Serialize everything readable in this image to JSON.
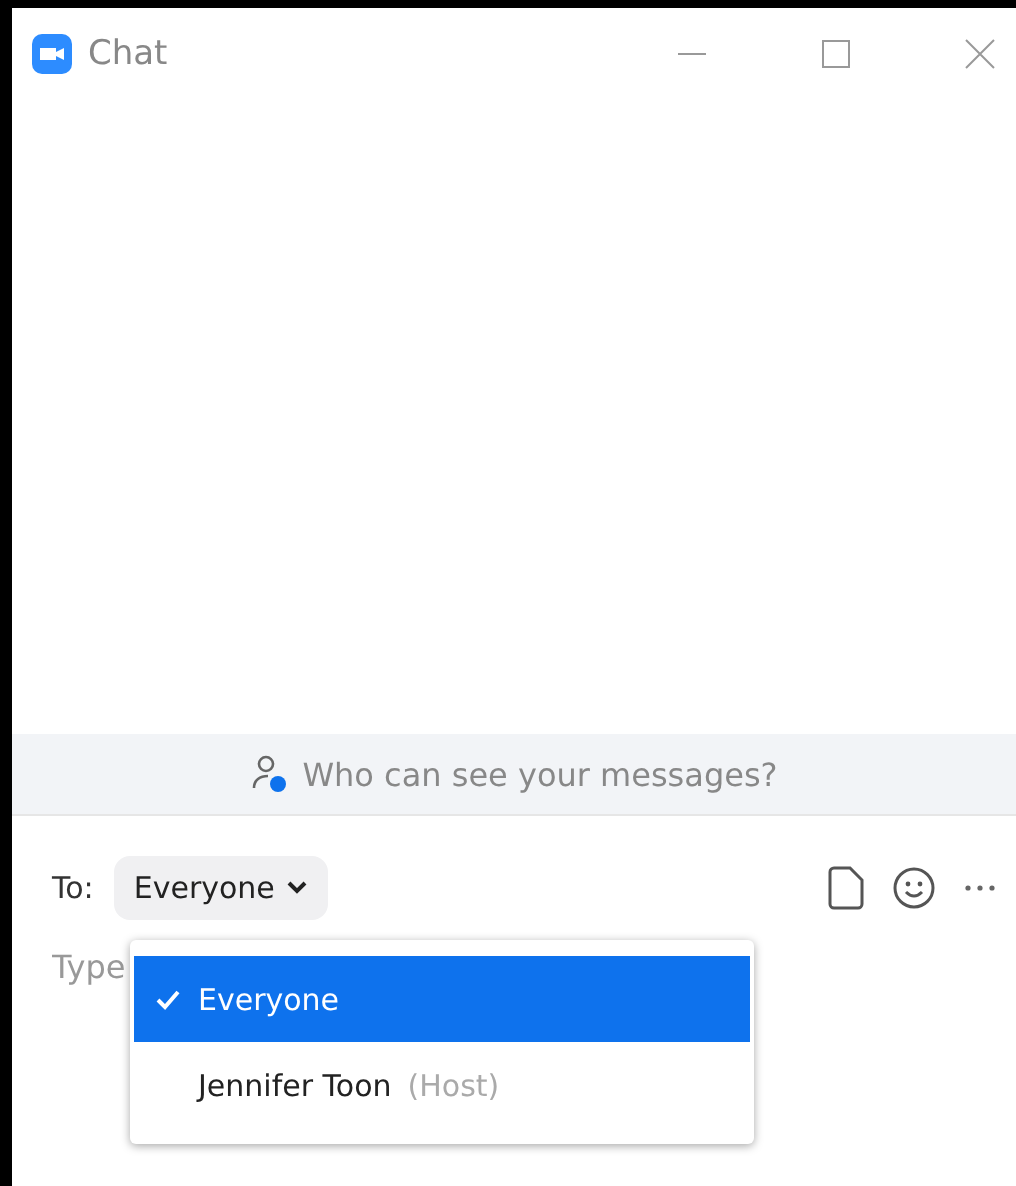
{
  "window": {
    "title": "Chat"
  },
  "banner": {
    "text": "Who can see your messages?"
  },
  "recipient": {
    "label": "To:",
    "value": "Everyone"
  },
  "message": {
    "placeholder": "Type"
  },
  "menu": [
    {
      "name": "Everyone",
      "selected": true
    },
    {
      "name": "Jennifer Toon",
      "role": "(Host)",
      "selected": false
    }
  ]
}
